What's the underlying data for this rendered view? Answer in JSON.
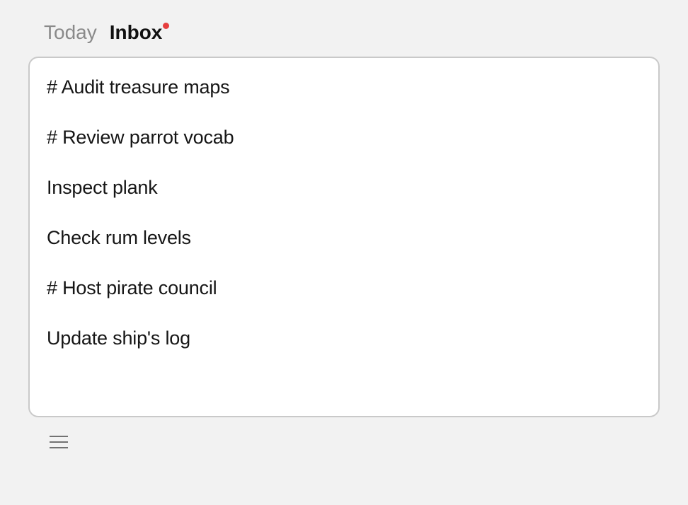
{
  "tabs": {
    "today": "Today",
    "inbox": "Inbox",
    "inbox_has_notification": true
  },
  "tasks": [
    {
      "text": "# Audit treasure maps"
    },
    {
      "text": "# Review parrot vocab"
    },
    {
      "text": "Inspect plank"
    },
    {
      "text": "Check rum levels"
    },
    {
      "text": "# Host pirate council"
    },
    {
      "text": "Update ship's log"
    }
  ],
  "icons": {
    "menu": "menu"
  }
}
